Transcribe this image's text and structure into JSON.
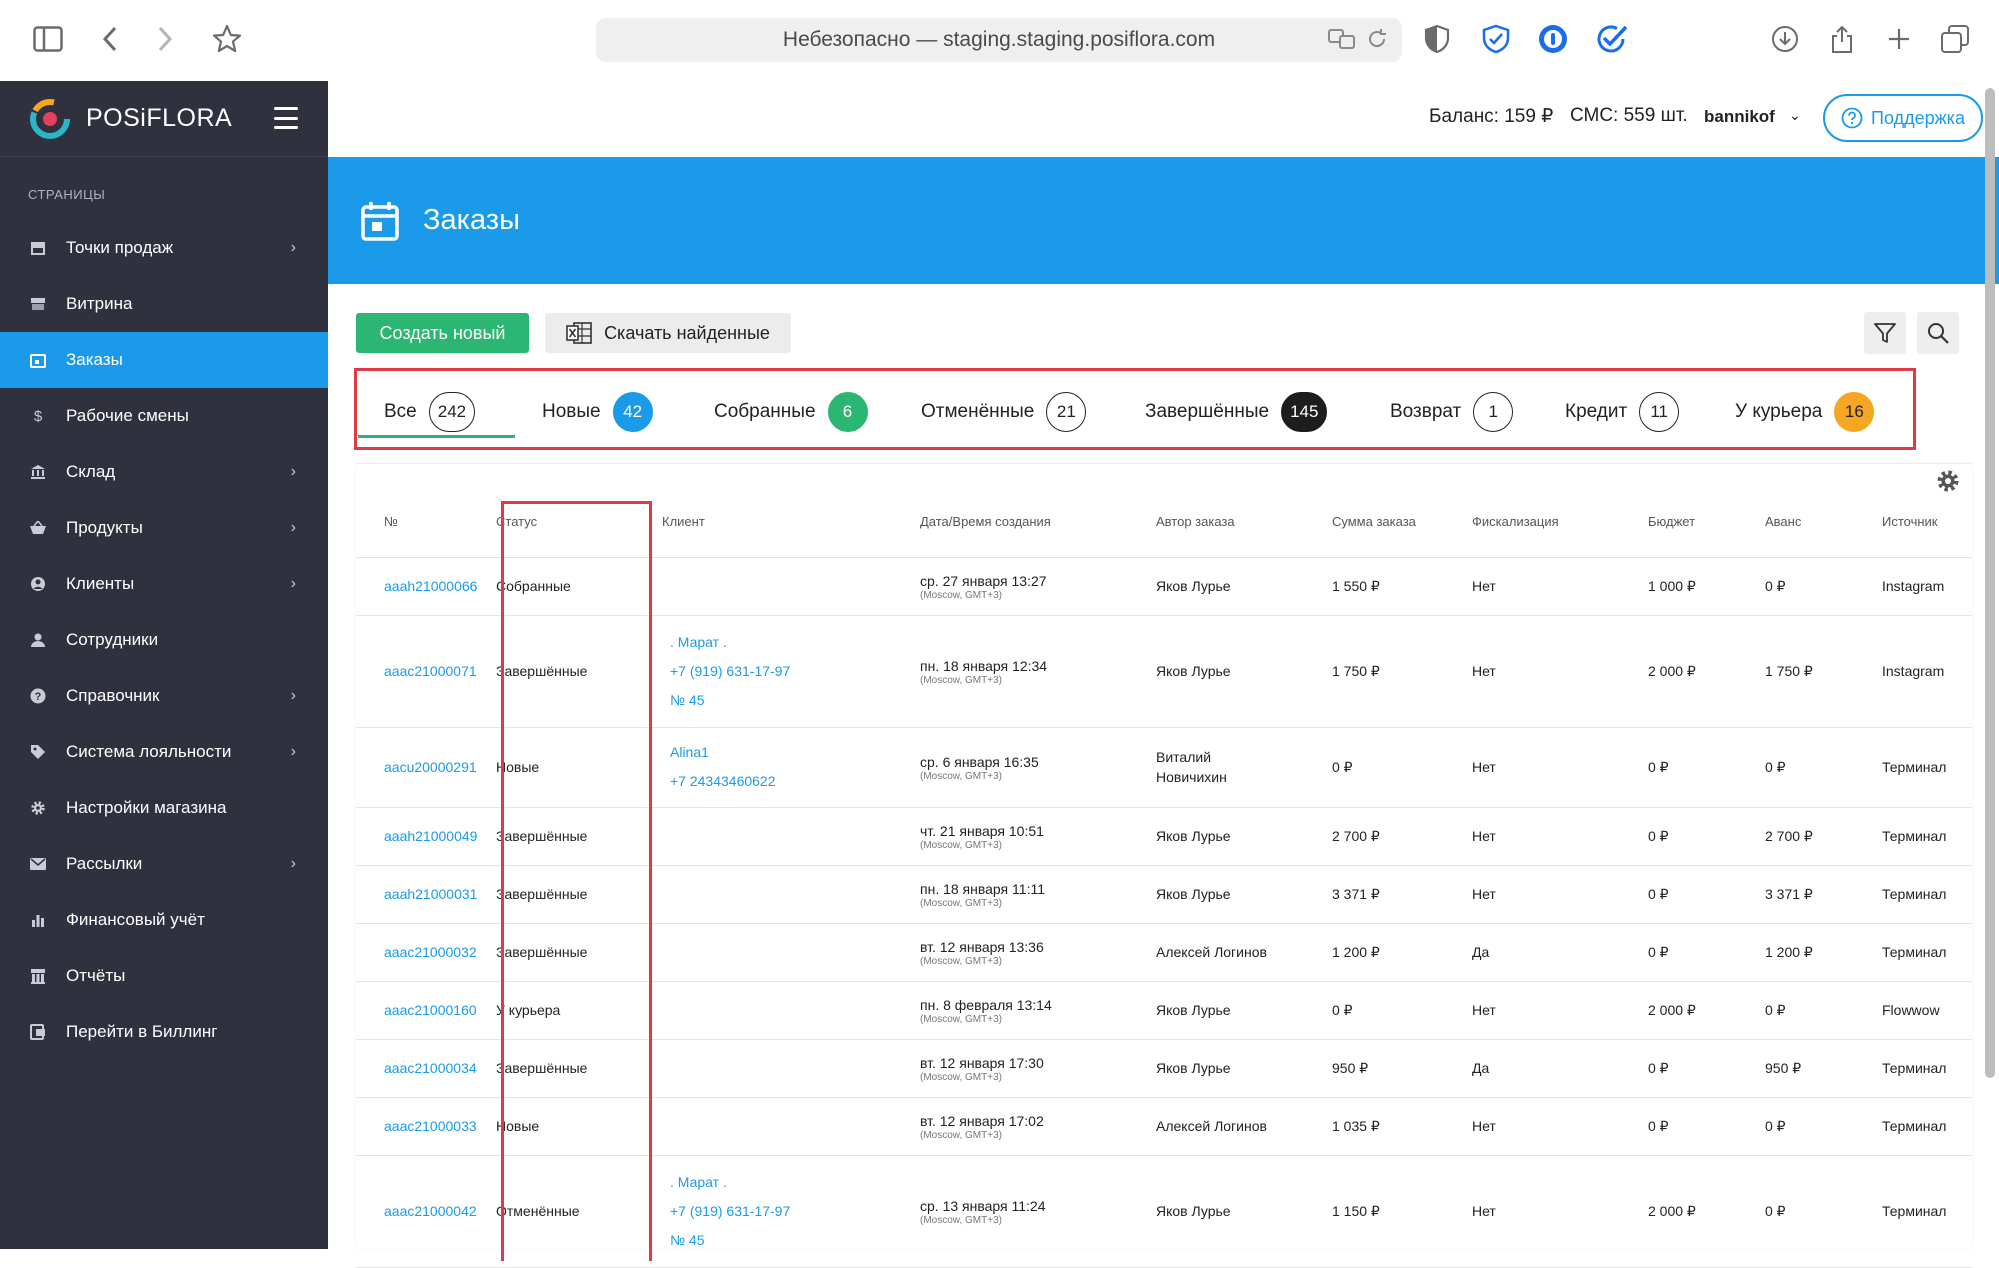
{
  "browser": {
    "address": "Небезопасно — staging.staging.posiflora.com"
  },
  "app": {
    "brand": "POSiFLORA",
    "balance": "Баланс: 159 ₽",
    "sms": "СМС: 559 шт.",
    "user": "bannikof",
    "support": "Поддержка"
  },
  "sidebar": {
    "section": "СТРАНИЦЫ",
    "items": [
      {
        "label": "Точки продаж",
        "icon": "store-icon",
        "chevron": true
      },
      {
        "label": "Витрина",
        "icon": "showcase-icon",
        "chevron": false
      },
      {
        "label": "Заказы",
        "icon": "calendar-icon",
        "chevron": false,
        "active": true
      },
      {
        "label": "Рабочие смены",
        "icon": "dollar-icon",
        "chevron": false
      },
      {
        "label": "Склад",
        "icon": "bank-icon",
        "chevron": true
      },
      {
        "label": "Продукты",
        "icon": "basket-icon",
        "chevron": true
      },
      {
        "label": "Клиенты",
        "icon": "client-icon",
        "chevron": true
      },
      {
        "label": "Сотрудники",
        "icon": "person-icon",
        "chevron": false
      },
      {
        "label": "Справочник",
        "icon": "help-icon",
        "chevron": true
      },
      {
        "label": "Система лояльности",
        "icon": "tag-icon",
        "chevron": true
      },
      {
        "label": "Настройки магазина",
        "icon": "gear-icon",
        "chevron": false
      },
      {
        "label": "Рассылки",
        "icon": "mail-icon",
        "chevron": true
      },
      {
        "label": "Финансовый учёт",
        "icon": "bar-chart-icon",
        "chevron": false
      },
      {
        "label": "Отчёты",
        "icon": "report-icon",
        "chevron": false
      },
      {
        "label": "Перейти в Биллинг",
        "icon": "billing-icon",
        "chevron": false
      }
    ]
  },
  "page": {
    "title": "Заказы",
    "create_label": "Создать новый",
    "download_label": "Скачать найденные"
  },
  "tabs": [
    {
      "label": "Все",
      "count": "242",
      "style": "outline"
    },
    {
      "label": "Новые",
      "count": "42",
      "style": "blue"
    },
    {
      "label": "Собранные",
      "count": "6",
      "style": "green"
    },
    {
      "label": "Отменённые",
      "count": "21",
      "style": "outline"
    },
    {
      "label": "Завершённые",
      "count": "145",
      "style": "black"
    },
    {
      "label": "Возврат",
      "count": "1",
      "style": "outline"
    },
    {
      "label": "Кредит",
      "count": "11",
      "style": "outline"
    },
    {
      "label": "У курьера",
      "count": "16",
      "style": "orange"
    }
  ],
  "table": {
    "headers": [
      "№",
      "Статус",
      "Клиент",
      "Дата/Время создания",
      "Автор заказа",
      "Сумма заказа",
      "Фискализация",
      "Бюджет",
      "Аванс",
      "Источник"
    ],
    "rows": [
      {
        "id": "aaah21000066",
        "status": "Собранные",
        "client": [],
        "date": "ср. 27 января 13:27",
        "tz": "(Moscow, GMT+3)",
        "author": "Яков Лурье",
        "sum": "1 550 ₽",
        "fiscal": "Нет",
        "budget": "1 000 ₽",
        "advance": "0 ₽",
        "source": "Instagram"
      },
      {
        "id": "aaac21000071",
        "status": "Завершённые",
        "client": [
          ". Марат .",
          "+7 (919) 631-17-97",
          "№ 45"
        ],
        "date": "пн. 18 января 12:34",
        "tz": "(Moscow, GMT+3)",
        "author": "Яков Лурье",
        "sum": "1 750 ₽",
        "fiscal": "Нет",
        "budget": "2 000 ₽",
        "advance": "1 750 ₽",
        "source": "Instagram"
      },
      {
        "id": "aacu20000291",
        "status": "Новые",
        "client": [
          "Alina1",
          "+7 24343460622"
        ],
        "date": "ср. 6 января 16:35",
        "tz": "(Moscow, GMT+3)",
        "author": "Виталий Новичихин",
        "sum": "0 ₽",
        "fiscal": "Нет",
        "budget": "0 ₽",
        "advance": "0 ₽",
        "source": "Терминал"
      },
      {
        "id": "aaah21000049",
        "status": "Завершённые",
        "client": [],
        "date": "чт. 21 января 10:51",
        "tz": "(Moscow, GMT+3)",
        "author": "Яков Лурье",
        "sum": "2 700 ₽",
        "fiscal": "Нет",
        "budget": "0 ₽",
        "advance": "2 700 ₽",
        "source": "Терминал"
      },
      {
        "id": "aaah21000031",
        "status": "Завершённые",
        "client": [],
        "date": "пн. 18 января 11:11",
        "tz": "(Moscow, GMT+3)",
        "author": "Яков Лурье",
        "sum": "3 371 ₽",
        "fiscal": "Нет",
        "budget": "0 ₽",
        "advance": "3 371 ₽",
        "source": "Терминал"
      },
      {
        "id": "aaac21000032",
        "status": "Завершённые",
        "client": [],
        "date": "вт. 12 января 13:36",
        "tz": "(Moscow, GMT+3)",
        "author": "Алексей Логинов",
        "sum": "1 200 ₽",
        "fiscal": "Да",
        "budget": "0 ₽",
        "advance": "1 200 ₽",
        "source": "Терминал"
      },
      {
        "id": "aaac21000160",
        "status": "У курьера",
        "client": [],
        "date": "пн. 8 февраля 13:14",
        "tz": "(Moscow, GMT+3)",
        "author": "Яков Лурье",
        "sum": "0 ₽",
        "fiscal": "Нет",
        "budget": "2 000 ₽",
        "advance": "0 ₽",
        "source": "Flowwow"
      },
      {
        "id": "aaac21000034",
        "status": "Завершённые",
        "client": [],
        "date": "вт. 12 января 17:30",
        "tz": "(Moscow, GMT+3)",
        "author": "Яков Лурье",
        "sum": "950 ₽",
        "fiscal": "Да",
        "budget": "0 ₽",
        "advance": "950 ₽",
        "source": "Терминал"
      },
      {
        "id": "aaac21000033",
        "status": "Новые",
        "client": [],
        "date": "вт. 12 января 17:02",
        "tz": "(Moscow, GMT+3)",
        "author": "Алексей Логинов",
        "sum": "1 035 ₽",
        "fiscal": "Нет",
        "budget": "0 ₽",
        "advance": "0 ₽",
        "source": "Терминал"
      },
      {
        "id": "aaac21000042",
        "status": "Отменённые",
        "client": [
          ". Марат .",
          "+7 (919) 631-17-97",
          "№ 45"
        ],
        "date": "ср. 13 января 11:24",
        "tz": "(Moscow, GMT+3)",
        "author": "Яков Лурье",
        "sum": "1 150 ₽",
        "fiscal": "Нет",
        "budget": "2 000 ₽",
        "advance": "0 ₽",
        "source": "Терминал"
      }
    ]
  },
  "colors": {
    "accent": "#1a9ae8",
    "sidebar": "#2f323e",
    "create": "#2bb673",
    "highlight": "#e03a44"
  }
}
